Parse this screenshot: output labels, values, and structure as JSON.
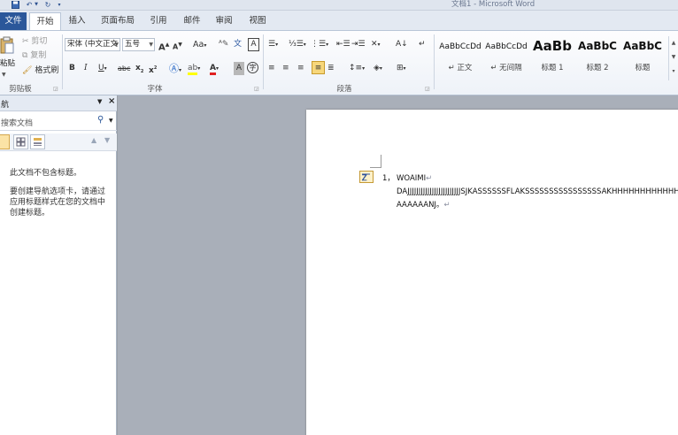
{
  "window": {
    "title": "文档1 - Microsoft Word",
    "quick_access": [
      "save-icon",
      "undo-icon",
      "redo-icon",
      "customize-icon"
    ]
  },
  "tabs": {
    "file": "文件",
    "items": [
      "开始",
      "插入",
      "页面布局",
      "引用",
      "邮件",
      "审阅",
      "视图"
    ],
    "active": "开始"
  },
  "ribbon": {
    "clipboard": {
      "label": "剪贴板",
      "paste": "粘贴",
      "cut": "剪切",
      "copy": "复制",
      "format_painter": "格式刷"
    },
    "font": {
      "label": "字体",
      "font_name": "宋体 (中文正文",
      "font_size": "五号",
      "grow": "A",
      "shrink": "A",
      "change_case": "Aa",
      "bold": "B",
      "italic": "I",
      "underline": "U",
      "strike": "abc",
      "subscript": "x",
      "superscript": "x",
      "font_color_letter": "A",
      "char_shade": "A"
    },
    "paragraph": {
      "label": "段落"
    },
    "styles": {
      "items": [
        {
          "preview": "AaBbCcDd",
          "name": "↵ 正文"
        },
        {
          "preview": "AaBbCcDd",
          "name": "↵ 无间隔"
        },
        {
          "preview": "AaBb",
          "name": "标题 1"
        },
        {
          "preview": "AaBbC",
          "name": "标题 2"
        },
        {
          "preview": "AaBbC",
          "name": "标题"
        }
      ]
    }
  },
  "nav_pane": {
    "title": "航",
    "search_placeholder": "搜索文档",
    "message_empty": "此文档不包含标题。",
    "message_help": "要创建导航选项卡，请通过应用标题样式在您的文档中创建标题。"
  },
  "document": {
    "list_number": "1，",
    "line1": "WOAIMI",
    "line2": "DAJJJJJJJJJJJJJJJJJJJJJJJJSJKASSSSSSFLAKSSSSSSSSSSSSSSSSAKHHHHHHHHHHHHHHH",
    "line3": "AAAAAANJ。",
    "paragraph_mark": "↵"
  },
  "colors": {
    "file_tab": "#2b579a",
    "highlight": "#ffff00",
    "font_color": "#e02020",
    "autocorrect_border": "#c59a35"
  }
}
